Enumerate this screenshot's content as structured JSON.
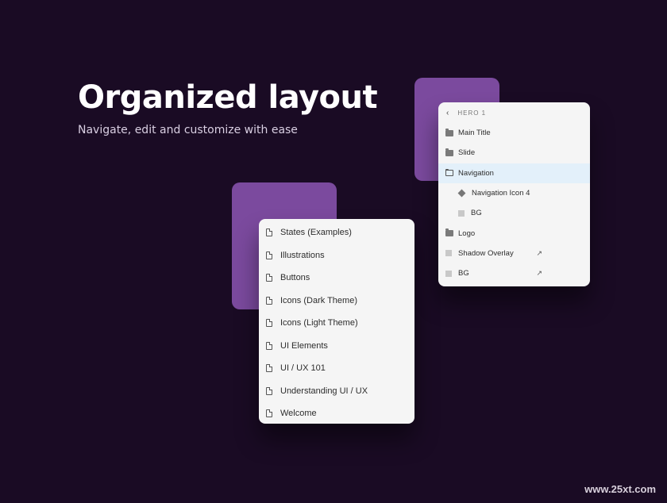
{
  "hero": {
    "title": "Organized layout",
    "subtitle": "Navigate, edit and customize with ease"
  },
  "pages": [
    {
      "label": "States (Examples)",
      "icon": "document-icon"
    },
    {
      "label": "Illustrations",
      "icon": "document-icon"
    },
    {
      "label": "Buttons",
      "icon": "document-icon"
    },
    {
      "label": "Icons (Dark Theme)",
      "icon": "document-icon"
    },
    {
      "label": "Icons (Light Theme)",
      "icon": "document-icon"
    },
    {
      "label": "UI Elements",
      "icon": "document-icon"
    },
    {
      "label": "UI / UX 101",
      "icon": "document-icon"
    },
    {
      "label": "Understanding UI / UX",
      "icon": "document-icon"
    },
    {
      "label": "Welcome",
      "icon": "document-icon"
    }
  ],
  "layers": {
    "header": "HERO 1",
    "back_icon": "chevron-left-icon",
    "items": [
      {
        "label": "Main Title",
        "icon": "folder-icon"
      },
      {
        "label": "Slide",
        "icon": "folder-icon"
      },
      {
        "label": "Navigation",
        "icon": "folder-outline-icon",
        "selected": true
      },
      {
        "label": "Navigation Icon 4",
        "icon": "component-icon"
      },
      {
        "label": "BG",
        "icon": "rectangle-icon"
      },
      {
        "label": "Logo",
        "icon": "folder-icon"
      },
      {
        "label": "Shadow Overlay",
        "icon": "rectangle-icon",
        "link_icon": "external-link-icon"
      },
      {
        "label": "BG",
        "icon": "rectangle-icon",
        "link_icon": "external-link-icon"
      }
    ]
  },
  "colors": {
    "background": "#1a0b24",
    "accent_purple": "#7b4a9e",
    "selection": "#e3f0fa",
    "panel": "#f5f5f5"
  },
  "watermark": "www.25xt.com"
}
